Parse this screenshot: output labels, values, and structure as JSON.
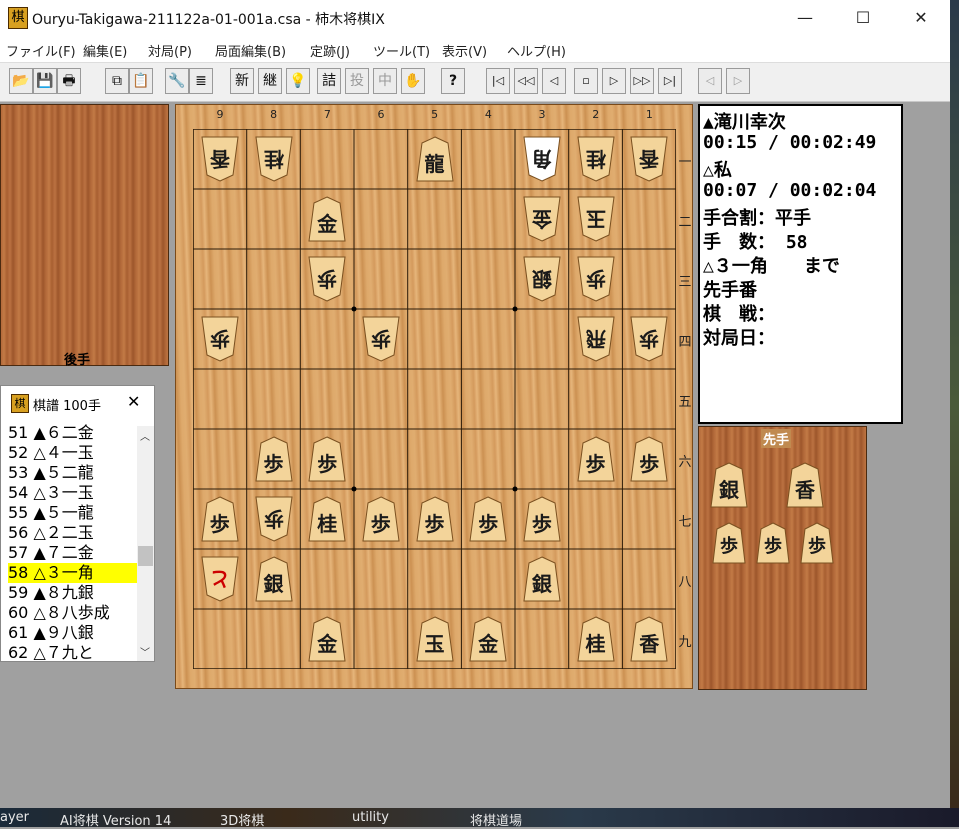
{
  "window": {
    "title": "Ouryu-Takigawa-211122a-01-001a.csa - 柿木将棋IX",
    "app_icon_glyph": "棋",
    "minimize": "—",
    "maximize": "☐",
    "close": "✕"
  },
  "menu": [
    "ファイル(F)",
    "編集(E)",
    "対局(P)",
    "局面編集(B)",
    "定跡(J)",
    "ツール(T)",
    "表示(V)",
    "ヘルプ(H)"
  ],
  "toolbar": {
    "open": "📂",
    "save": "💾",
    "print": "🖶",
    "copy": "⧉",
    "paste": "📋",
    "tools": "🔧",
    "list": "≣",
    "new": "新",
    "continue": "継",
    "hint": "💡",
    "mate": "詰",
    "resign": "投",
    "pause": "中",
    "hand": "✋",
    "help": "?",
    "first": "|◁",
    "back_many": "◁◁",
    "back": "◁",
    "stop": "▫",
    "forward": "▷",
    "forward_many": "▷▷",
    "last": "▷|",
    "branch_prev": "◁",
    "branch_next": "▷"
  },
  "board": {
    "col_labels": [
      "9",
      "8",
      "7",
      "6",
      "5",
      "4",
      "3",
      "2",
      "1"
    ],
    "row_labels": [
      "一",
      "二",
      "三",
      "四",
      "五",
      "六",
      "七",
      "八",
      "九"
    ],
    "pieces": [
      {
        "file": 9,
        "rank": 1,
        "char": "香",
        "owner": "gote"
      },
      {
        "file": 8,
        "rank": 1,
        "char": "桂",
        "owner": "gote"
      },
      {
        "file": 5,
        "rank": 1,
        "char": "龍",
        "owner": "sente",
        "promoted": false
      },
      {
        "file": 3,
        "rank": 1,
        "char": "角",
        "owner": "gote",
        "highlight": true
      },
      {
        "file": 2,
        "rank": 1,
        "char": "桂",
        "owner": "gote"
      },
      {
        "file": 1,
        "rank": 1,
        "char": "香",
        "owner": "gote"
      },
      {
        "file": 7,
        "rank": 2,
        "char": "金",
        "owner": "sente"
      },
      {
        "file": 3,
        "rank": 2,
        "char": "金",
        "owner": "gote"
      },
      {
        "file": 2,
        "rank": 2,
        "char": "玉",
        "owner": "gote"
      },
      {
        "file": 7,
        "rank": 3,
        "char": "歩",
        "owner": "gote"
      },
      {
        "file": 3,
        "rank": 3,
        "char": "銀",
        "owner": "gote"
      },
      {
        "file": 2,
        "rank": 3,
        "char": "歩",
        "owner": "gote"
      },
      {
        "file": 9,
        "rank": 4,
        "char": "歩",
        "owner": "gote"
      },
      {
        "file": 6,
        "rank": 4,
        "char": "歩",
        "owner": "gote"
      },
      {
        "file": 2,
        "rank": 4,
        "char": "飛",
        "owner": "gote"
      },
      {
        "file": 1,
        "rank": 4,
        "char": "歩",
        "owner": "gote"
      },
      {
        "file": 8,
        "rank": 6,
        "char": "歩",
        "owner": "sente"
      },
      {
        "file": 7,
        "rank": 6,
        "char": "歩",
        "owner": "sente"
      },
      {
        "file": 2,
        "rank": 6,
        "char": "歩",
        "owner": "sente"
      },
      {
        "file": 1,
        "rank": 6,
        "char": "歩",
        "owner": "sente"
      },
      {
        "file": 9,
        "rank": 7,
        "char": "歩",
        "owner": "sente"
      },
      {
        "file": 8,
        "rank": 7,
        "char": "歩",
        "owner": "gote"
      },
      {
        "file": 7,
        "rank": 7,
        "char": "桂",
        "owner": "sente"
      },
      {
        "file": 6,
        "rank": 7,
        "char": "歩",
        "owner": "sente"
      },
      {
        "file": 5,
        "rank": 7,
        "char": "歩",
        "owner": "sente"
      },
      {
        "file": 4,
        "rank": 7,
        "char": "歩",
        "owner": "sente"
      },
      {
        "file": 3,
        "rank": 7,
        "char": "歩",
        "owner": "sente"
      },
      {
        "file": 9,
        "rank": 8,
        "char": "と",
        "owner": "gote",
        "promoted": true
      },
      {
        "file": 8,
        "rank": 8,
        "char": "銀",
        "owner": "sente"
      },
      {
        "file": 3,
        "rank": 8,
        "char": "銀",
        "owner": "sente"
      },
      {
        "file": 7,
        "rank": 9,
        "char": "金",
        "owner": "sente"
      },
      {
        "file": 5,
        "rank": 9,
        "char": "玉",
        "owner": "sente"
      },
      {
        "file": 4,
        "rank": 9,
        "char": "金",
        "owner": "sente"
      },
      {
        "file": 2,
        "rank": 9,
        "char": "桂",
        "owner": "sente"
      },
      {
        "file": 1,
        "rank": 9,
        "char": "香",
        "owner": "sente"
      }
    ]
  },
  "gote_stand": {
    "label": "後手"
  },
  "sente_stand": {
    "label": "先手",
    "pieces": [
      "銀",
      "香",
      "歩",
      "歩",
      "歩"
    ]
  },
  "info": {
    "sente_name": "▲滝川幸次",
    "sente_time": "00:15 / 00:02:49",
    "gote_name": "△私",
    "gote_time": "00:07 / 00:02:04",
    "handicap": "手合割：平手",
    "move_count": "手　数： 58",
    "last_move": "△３一角　　まで",
    "turn": "先手番",
    "event": "棋　戦：",
    "date": "対局日："
  },
  "kifu": {
    "title": "棋譜 100手",
    "close": "✕",
    "moves": [
      "51 ▲６二金",
      "52 △４一玉",
      "53 ▲５二龍",
      "54 △３一玉",
      "55 ▲５一龍",
      "56 △２二玉",
      "57 ▲７二金",
      "58 △３一角",
      "59 ▲８九銀",
      "60 △８八歩成",
      "61 ▲９八銀",
      "62 △７九と"
    ],
    "selected_index": 7
  },
  "taskbar": [
    "ayer",
    "AI将棋 Version 14",
    "3D将棋",
    "utility",
    "将棋道場"
  ]
}
